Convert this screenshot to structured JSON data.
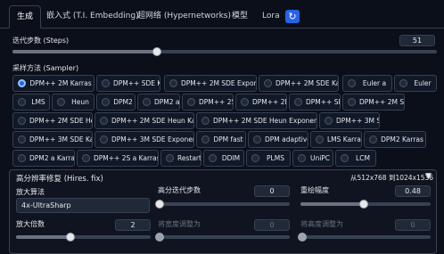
{
  "tabs": [
    "生成",
    "嵌入式 (T.I. Embedding)",
    "超网络 (Hypernetworks)",
    "模型",
    "Lora"
  ],
  "refresh_icon": "refresh-icon",
  "steps": {
    "label": "迭代步数 (Steps)",
    "value": "51",
    "level": 0.34
  },
  "sampler": {
    "label": "采样方法 (Sampler)",
    "selected": "DPM++ 2M Karras",
    "options": [
      "DPM++ 2M Karras",
      "DPM++ SDE Karras",
      "DPM++ 2M SDE Exponential",
      "DPM++ 2M SDE Karras",
      "Euler a",
      "Euler",
      "LMS",
      "Heun",
      "DPM2",
      "DPM2 a",
      "DPM++ 2S a",
      "DPM++ 2M",
      "DPM++ SDE",
      "DPM++ 2M SDE",
      "DPM++ 2M SDE Heun",
      "DPM++ 2M SDE Heun Karras",
      "DPM++ 2M SDE Heun Exponential",
      "DPM++ 3M SDE",
      "DPM++ 3M SDE Karras",
      "DPM++ 3M SDE Exponential",
      "DPM fast",
      "DPM adaptive",
      "LMS Karras",
      "DPM2 Karras",
      "DPM2 a Karras",
      "DPM++ 2S a Karras",
      "Restart",
      "DDIM",
      "PLMS",
      "UniPC",
      "LCM"
    ]
  },
  "hires": {
    "title": "高分辨率修复 (Hires. fix)",
    "resolution_note": "从512x768 到1024x1536",
    "upscaler_label": "放大算法",
    "upscaler_value": "4x-UltraSharp",
    "steps_label": "高分迭代步数",
    "steps_value": "0",
    "denoise_label": "重绘幅度",
    "denoise_value": "0.48",
    "scale_label": "放大倍数",
    "scale_value": "2",
    "width_label": "将宽度调整为",
    "width_value": "0",
    "height_label": "将高度调整为",
    "height_value": "0"
  }
}
